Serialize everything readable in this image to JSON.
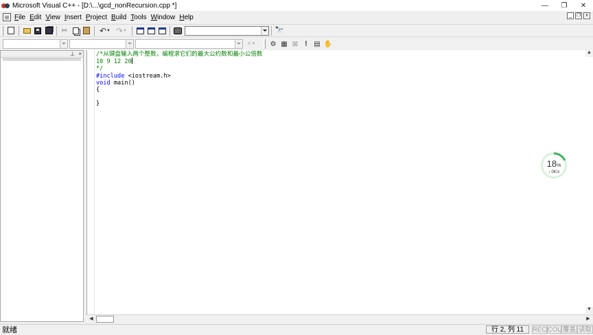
{
  "window": {
    "title": "Microsoft Visual C++ - [D:\\...\\gcd_nonRecursion.cpp *]",
    "controls": [
      "—",
      "❐",
      "✕"
    ]
  },
  "menu": [
    {
      "key": "F",
      "rest": "ile"
    },
    {
      "key": "E",
      "rest": "dit"
    },
    {
      "key": "V",
      "rest": "iew"
    },
    {
      "key": "I",
      "rest": "nsert"
    },
    {
      "key": "P",
      "rest": "roject"
    },
    {
      "key": "B",
      "rest": "uild"
    },
    {
      "key": "T",
      "rest": "ools"
    },
    {
      "key": "W",
      "rest": "indow"
    },
    {
      "key": "H",
      "rest": "elp"
    }
  ],
  "mdi_controls": [
    "_",
    "❐",
    "x"
  ],
  "toolbar": {
    "find_combo_value": ""
  },
  "wizard_bar": {
    "class_combo": "",
    "filter_combo": "",
    "members_combo": ""
  },
  "workspace": {
    "pin_label": "⊥",
    "close_label": "×"
  },
  "editor": {
    "lines": [
      {
        "kind": "comment",
        "text": "/*从键盘输入两个整数，编程求它们的最大公约数和最小公倍数"
      },
      {
        "kind": "comment-caret",
        "before": "10 9 12 20",
        "after": ""
      },
      {
        "kind": "comment",
        "text": "*/"
      },
      {
        "kind": "include",
        "kw": "#include",
        "rest": " <iostream.h>"
      },
      {
        "kind": "decl",
        "kw": "void",
        "rest": " main()"
      },
      {
        "kind": "plain",
        "text": "{"
      },
      {
        "kind": "plain",
        "text": ""
      },
      {
        "kind": "plain",
        "text": "}"
      }
    ]
  },
  "net_widget": {
    "percent": "18",
    "percent_unit": "%",
    "speed": "↓ 0K/s",
    "progress": 0.18
  },
  "statusbar": {
    "message": "就绪",
    "position": "行 2, 列 11",
    "indicators": [
      "REC",
      "COL",
      "覆盖",
      "读取"
    ]
  },
  "colors": {
    "comment": "#008000",
    "keyword": "#0000ff",
    "net_ring": "#3cb35b"
  }
}
